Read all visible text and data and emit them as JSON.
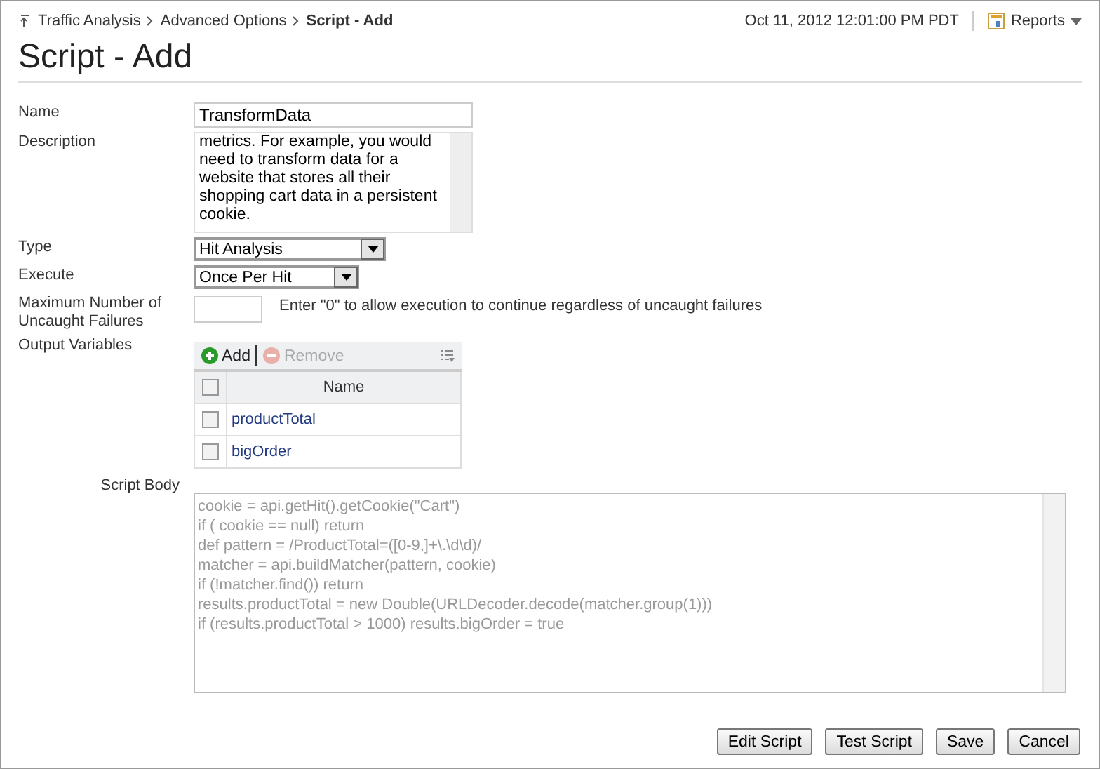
{
  "breadcrumb": [
    {
      "label": "Traffic Analysis",
      "current": false
    },
    {
      "label": "Advanced Options",
      "current": false
    },
    {
      "label": "Script - Add",
      "current": true
    }
  ],
  "timestamp": "Oct 11, 2012 12:01:00 PM PDT",
  "reports_menu": "Reports",
  "title": "Script - Add",
  "form": {
    "name_label": "Name",
    "name_value": "TransformData",
    "description_label": "Description",
    "description_value": "metrics. For example, you would need to transform data for a website that stores all their shopping cart data in a persistent cookie.",
    "type_label": "Type",
    "type_value": "Hit Analysis",
    "execute_label": "Execute",
    "execute_value": "Once Per Hit",
    "max_failures_label": "Maximum Number of Uncaught Failures",
    "max_failures_hint": "Enter \"0\" to allow execution to continue regardless of uncaught failures",
    "output_label": "Output Variables",
    "toolbar": [
      {
        "label": "Add",
        "kind": "add",
        "disabled": false
      },
      {
        "label": "Remove",
        "kind": "remove",
        "disabled": true
      }
    ],
    "table": {
      "header_checked": false,
      "columns": [
        "Name"
      ],
      "rows": [
        {
          "name": "productTotal",
          "checked": false
        },
        {
          "name": "bigOrder",
          "checked": false
        }
      ]
    },
    "script_label": "Script Body",
    "script_lines": [
      "cookie = api.getHit().getCookie(\"Cart\")",
      "if ( cookie == null) return",
      "def pattern = /ProductTotal=([0-9,]+\\.\\d\\d)/",
      "matcher = api.buildMatcher(pattern, cookie)",
      "if (!matcher.find()) return",
      "results.productTotal = new Double(URLDecoder.decode(matcher.group(1)))",
      "if (results.productTotal > 1000) results.bigOrder = true"
    ]
  },
  "buttons": [
    "Edit Script",
    "Test Script",
    "Save",
    "Cancel"
  ]
}
